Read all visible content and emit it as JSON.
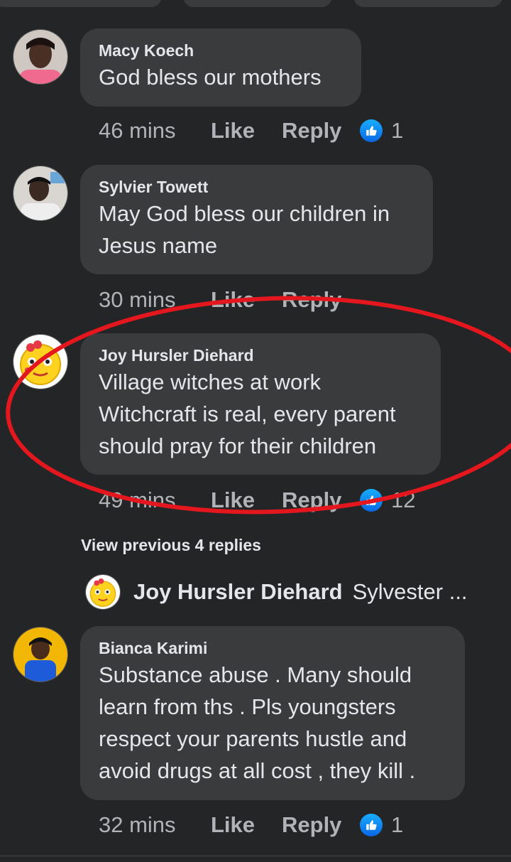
{
  "comments": [
    {
      "author": "Macy Koech",
      "text_lines": [
        "God bless our mothers"
      ],
      "time": "46 mins",
      "like_label": "Like",
      "reply_label": "Reply",
      "reaction_count": "1",
      "reaction_icon": "thumbs-up-icon"
    },
    {
      "author": "Sylvier Towett",
      "text_lines": [
        "May God bless our children in",
        "Jesus name"
      ],
      "time": "30 mins",
      "like_label": "Like",
      "reply_label": "Reply"
    },
    {
      "author": "Joy Hursler Diehard",
      "text_lines": [
        "Village witches at work",
        "Witchcraft is real, every parent",
        "should pray for their children"
      ],
      "time": "49 mins",
      "like_label": "Like",
      "reply_label": "Reply",
      "reaction_count": "12",
      "reaction_icon": "thumbs-up-icon"
    },
    {
      "author": "Bianca Karimi",
      "text_lines": [
        "Substance abuse . Many should",
        "learn from ths . Pls youngsters",
        "respect your parents hustle and",
        "avoid drugs at all cost , they kill ."
      ],
      "time": "32 mins",
      "like_label": "Like",
      "reply_label": "Reply",
      "reaction_count": "1",
      "reaction_icon": "thumbs-up-icon"
    }
  ],
  "view_previous": "View previous 4 replies",
  "nested_reply": {
    "author": "Joy Hursler Diehard",
    "text": "Sylvester ..."
  },
  "colors": {
    "background": "#242526",
    "bubble": "#3a3b3c",
    "highlight": "#e3171d",
    "reaction_blue": "#0a66e3"
  }
}
